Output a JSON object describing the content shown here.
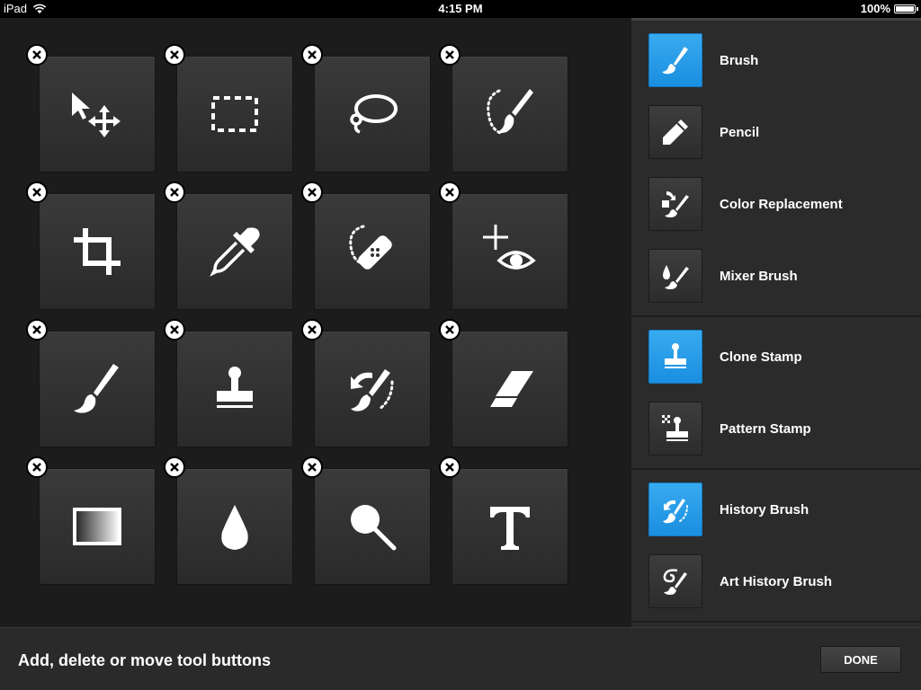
{
  "status_bar": {
    "device": "iPad",
    "time": "4:15 PM",
    "battery": "100%"
  },
  "grid": {
    "tools": [
      {
        "icon": "move-icon"
      },
      {
        "icon": "marquee-icon"
      },
      {
        "icon": "lasso-icon"
      },
      {
        "icon": "quick-selection-icon"
      },
      {
        "icon": "crop-icon"
      },
      {
        "icon": "eyedropper-icon"
      },
      {
        "icon": "healing-brush-icon"
      },
      {
        "icon": "red-eye-icon"
      },
      {
        "icon": "brush-icon"
      },
      {
        "icon": "clone-stamp-icon"
      },
      {
        "icon": "history-brush-icon"
      },
      {
        "icon": "eraser-icon"
      },
      {
        "icon": "gradient-icon"
      },
      {
        "icon": "blur-drop-icon"
      },
      {
        "icon": "dodge-icon"
      },
      {
        "icon": "type-icon"
      }
    ]
  },
  "side_panel": {
    "groups": [
      {
        "items": [
          {
            "label": "Brush",
            "icon": "brush-icon",
            "active": true
          },
          {
            "label": "Pencil",
            "icon": "pencil-icon",
            "active": false
          },
          {
            "label": "Color Replacement",
            "icon": "color-replacement-icon",
            "active": false
          },
          {
            "label": "Mixer Brush",
            "icon": "mixer-brush-icon",
            "active": false
          }
        ]
      },
      {
        "items": [
          {
            "label": "Clone Stamp",
            "icon": "clone-stamp-icon",
            "active": true
          },
          {
            "label": "Pattern Stamp",
            "icon": "pattern-stamp-icon",
            "active": false
          }
        ]
      },
      {
        "items": [
          {
            "label": "History Brush",
            "icon": "history-brush-icon",
            "active": true
          },
          {
            "label": "Art History Brush",
            "icon": "art-history-brush-icon",
            "active": false
          }
        ]
      }
    ]
  },
  "bottom_bar": {
    "hint": "Add, delete or move tool buttons",
    "done_label": "DONE"
  },
  "colors": {
    "accent": "#1e94e4",
    "tile": "#333333",
    "background": "#1c1c1c"
  }
}
